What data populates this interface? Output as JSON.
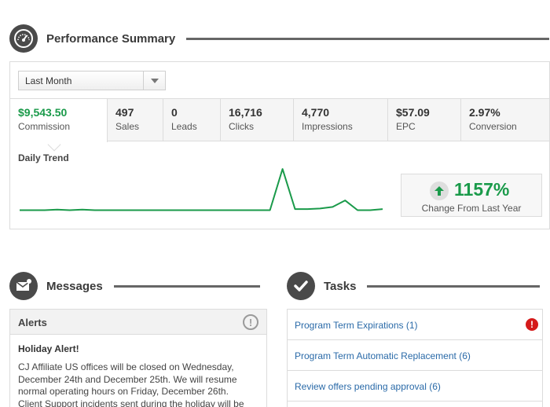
{
  "performance": {
    "title": "Performance Summary",
    "period_select": {
      "selected": "Last Month"
    },
    "metrics": [
      {
        "value": "$9,543.50",
        "label": "Commission"
      },
      {
        "value": "497",
        "label": "Sales"
      },
      {
        "value": "0",
        "label": "Leads"
      },
      {
        "value": "16,716",
        "label": "Clicks"
      },
      {
        "value": "4,770",
        "label": "Impressions"
      },
      {
        "value": "$57.09",
        "label": "EPC"
      },
      {
        "value": "2.97%",
        "label": "Conversion"
      }
    ],
    "trend_title": "Daily Trend",
    "change": {
      "value": "1157%",
      "label": "Change From Last Year"
    },
    "colors": {
      "accent": "#1a9a4a",
      "link": "#2a6aa8",
      "alert": "#d51a1a"
    }
  },
  "chart_data": {
    "type": "line",
    "title": "Daily Trend",
    "x": [
      1,
      2,
      3,
      4,
      5,
      6,
      7,
      8,
      9,
      10,
      11,
      12,
      13,
      14,
      15,
      16,
      17,
      18,
      19,
      20,
      21,
      22,
      23,
      24,
      25,
      26,
      27,
      28,
      29,
      30
    ],
    "series": [
      {
        "values": [
          4,
          4,
          4,
          4.5,
          4,
          4.5,
          4,
          4,
          4,
          4,
          4,
          4,
          4,
          4,
          4,
          4,
          4,
          4,
          4,
          4,
          4,
          42,
          5,
          5,
          5.5,
          7,
          13,
          4,
          4,
          5
        ]
      }
    ],
    "ylim": [
      0,
      45
    ],
    "grid": false,
    "axes_visible": false,
    "color": "#1a9a4a"
  },
  "messages": {
    "title": "Messages",
    "alerts_title": "Alerts",
    "alerts_info_glyph": "!",
    "alert_heading": "Holiday Alert!",
    "alert_body": "CJ Affiliate US offices will be closed on Wednesday, December 24th and December 25th. We will resume normal operating hours on Friday, December 26th. Client Support incidents sent during the holiday will be handled"
  },
  "tasks": {
    "title": "Tasks",
    "alert_glyph": "!",
    "items": [
      {
        "label": "Program Term Expirations (1)"
      },
      {
        "label": "Program Term Automatic Replacement (6)"
      },
      {
        "label": "Review offers pending approval (6)"
      }
    ]
  },
  "icons": {
    "performance": "speedometer-icon",
    "messages": "envelope-icon",
    "tasks": "checkmark-icon"
  }
}
